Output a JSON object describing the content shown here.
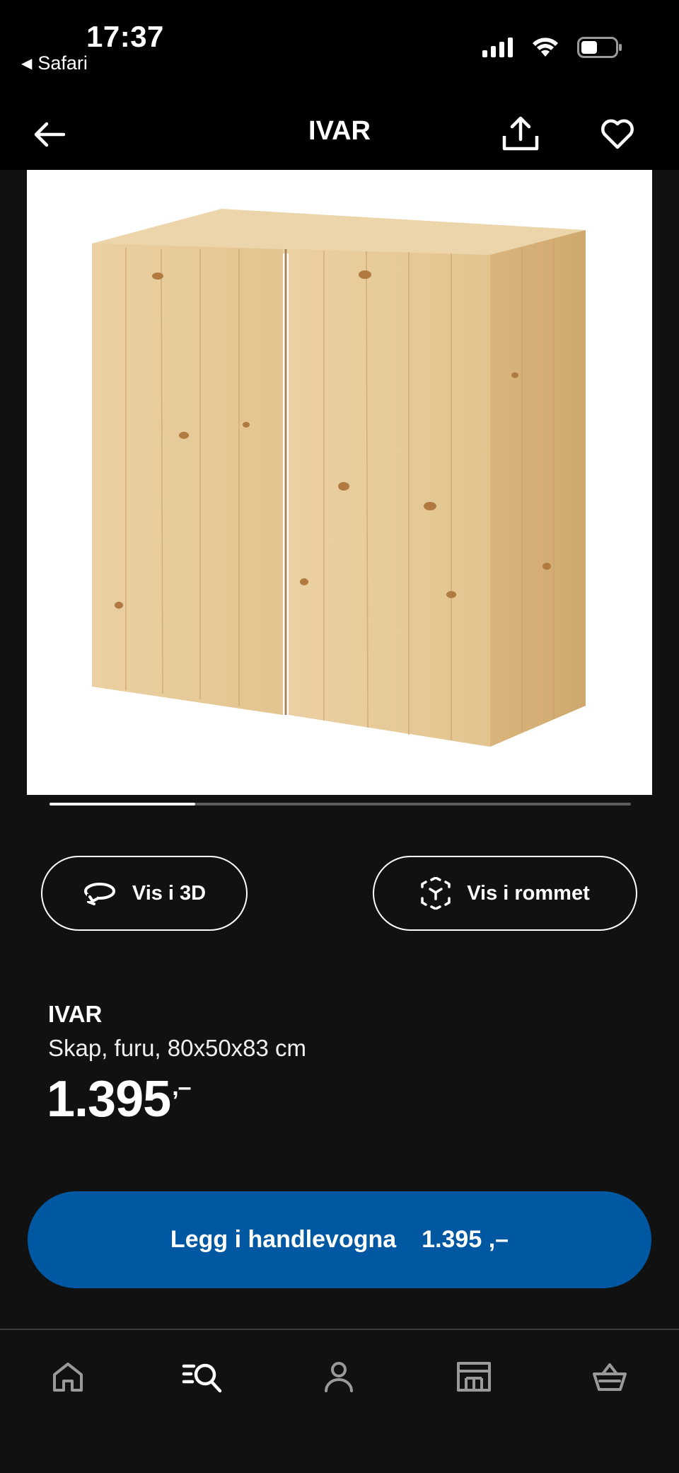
{
  "status_bar": {
    "time": "17:37",
    "back_app": "Safari",
    "icons": [
      "cellular-signal-icon",
      "wifi-icon",
      "battery-icon"
    ]
  },
  "header": {
    "title": "IVAR",
    "icons": [
      "arrow-left-icon",
      "share-icon",
      "heart-icon"
    ]
  },
  "carousel": {
    "progress": 0.25
  },
  "actions": {
    "view_3d": "Vis i 3D",
    "view_room": "Vis i rommet"
  },
  "product": {
    "name": "IVAR",
    "description": "Skap, furu, 80x50x83 cm",
    "price": "1.395",
    "price_suffix": ",–"
  },
  "cart_button": {
    "label": "Legg i handlevogna",
    "price": "1.395 ,–"
  },
  "bottom_nav": {
    "items": [
      "home-icon",
      "search-icon",
      "profile-icon",
      "store-icon",
      "basket-icon"
    ]
  },
  "colors": {
    "background": "#111111",
    "bar": "#000000",
    "accent": "#0058a3",
    "text": "#ffffff",
    "wood": "#e2c291"
  }
}
